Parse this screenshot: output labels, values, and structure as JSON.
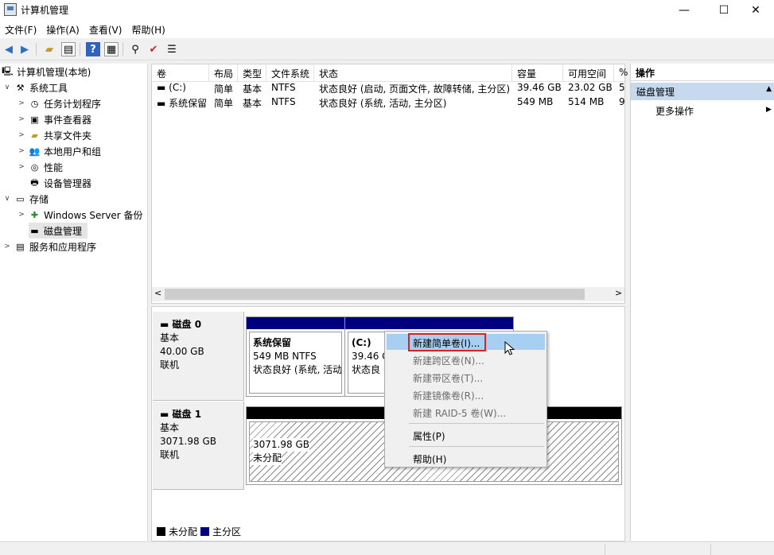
{
  "window": {
    "title": "计算机管理",
    "minimize": "—",
    "maximize": "☐",
    "close": "✕"
  },
  "menu": [
    "文件(F)",
    "操作(A)",
    "查看(V)",
    "帮助(H)"
  ],
  "toolbar_icons": [
    "back-icon",
    "forward-icon",
    "up-folder-icon",
    "show-hide-tree-icon",
    "help-icon",
    "properties-icon",
    "connect-icon",
    "check-icon",
    "list-icon"
  ],
  "tree": {
    "root": "计算机管理(本地)",
    "system_tools": "系统工具",
    "task_scheduler": "任务计划程序",
    "event_viewer": "事件查看器",
    "shared_folders": "共享文件夹",
    "local_users": "本地用户和组",
    "performance": "性能",
    "device_manager": "设备管理器",
    "storage": "存储",
    "windows_backup": "Windows Server 备份",
    "disk_management": "磁盘管理",
    "services_apps": "服务和应用程序"
  },
  "volume_list": {
    "columns": [
      "卷",
      "布局",
      "类型",
      "文件系统",
      "状态",
      "容量",
      "可用空间",
      "%"
    ],
    "rows": [
      [
        "(C:)",
        "简单",
        "基本",
        "NTFS",
        "状态良好 (启动, 页面文件, 故障转储, 主分区)",
        "39.46 GB",
        "23.02 GB",
        "5"
      ],
      [
        "系统保留",
        "简单",
        "基本",
        "NTFS",
        "状态良好 (系统, 活动, 主分区)",
        "549 MB",
        "514 MB",
        "9"
      ]
    ]
  },
  "disks": [
    {
      "name": "磁盘 0",
      "type": "基本",
      "size": "40.00 GB",
      "status": "联机",
      "volumes": [
        {
          "name": "系统保留",
          "detail": "549 MB NTFS",
          "status": "状态良好 (系统, 活动"
        },
        {
          "name": "(C:)",
          "detail": "39.46 G",
          "status": "状态良"
        }
      ]
    },
    {
      "name": "磁盘 1",
      "type": "基本",
      "size": "3071.98 GB",
      "status": "联机",
      "volumes": [
        {
          "name": "",
          "detail": "3071.98 GB",
          "status": "未分配"
        }
      ]
    }
  ],
  "legend": {
    "unallocated": "未分配",
    "primary": "主分区",
    "colors": {
      "unallocated": "#000000",
      "primary": "#00007f"
    }
  },
  "actions": {
    "header": "操作",
    "section": "磁盘管理",
    "more": "更多操作"
  },
  "context_menu": {
    "items": [
      "新建简单卷(I)...",
      "新建跨区卷(N)...",
      "新建带区卷(T)...",
      "新建镜像卷(R)...",
      "新建 RAID-5 卷(W)...",
      "属性(P)",
      "帮助(H)"
    ]
  },
  "colors": {
    "primary_partition": "#00007f",
    "highlight": "#a6cff2",
    "selection_box": "#e02020",
    "actions_section": "#c6d9ee"
  }
}
